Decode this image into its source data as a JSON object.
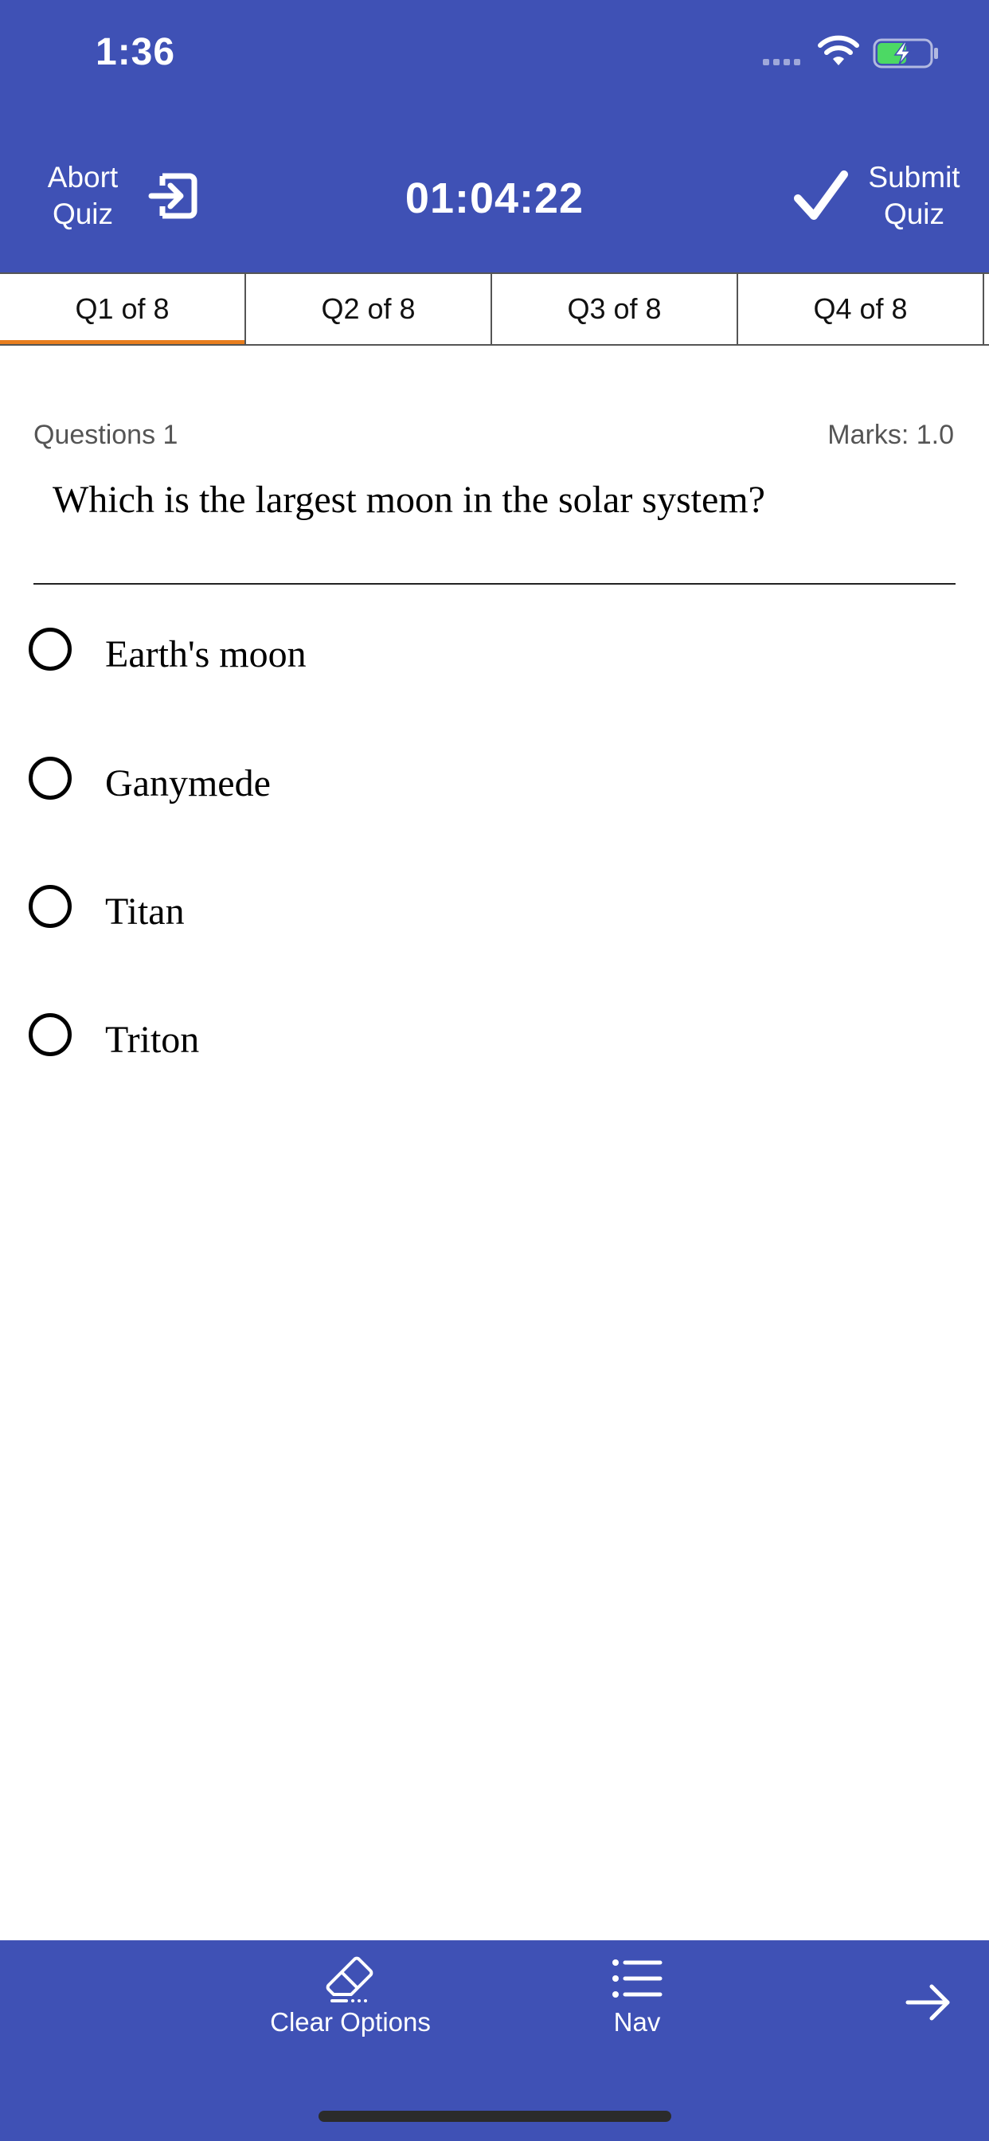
{
  "status_bar": {
    "time": "1:36",
    "battery_state": "charging",
    "wifi": "connected"
  },
  "header": {
    "abort_line1": "Abort",
    "abort_line2": "Quiz",
    "timer": "01:04:22",
    "submit_line1": "Submit",
    "submit_line2": "Quiz",
    "color": "#3f51b5"
  },
  "tabs": [
    {
      "label": "Q1 of 8",
      "active": true
    },
    {
      "label": "Q2 of 8",
      "active": false
    },
    {
      "label": "Q3 of 8",
      "active": false
    },
    {
      "label": "Q4 of 8",
      "active": false
    }
  ],
  "tab_active_color": "#e87e1e",
  "question": {
    "number_label": "Questions 1",
    "marks_label": "Marks: 1.0",
    "text": "Which is the largest moon in the solar system?"
  },
  "options": [
    {
      "label": "Earth's moon",
      "selected": false
    },
    {
      "label": "Ganymede",
      "selected": false
    },
    {
      "label": "Titan",
      "selected": false
    },
    {
      "label": "Triton",
      "selected": false
    }
  ],
  "footer": {
    "clear_label": "Clear Options",
    "nav_label": "Nav",
    "icons": [
      "eraser-icon",
      "list-icon",
      "arrow-right-icon"
    ]
  }
}
